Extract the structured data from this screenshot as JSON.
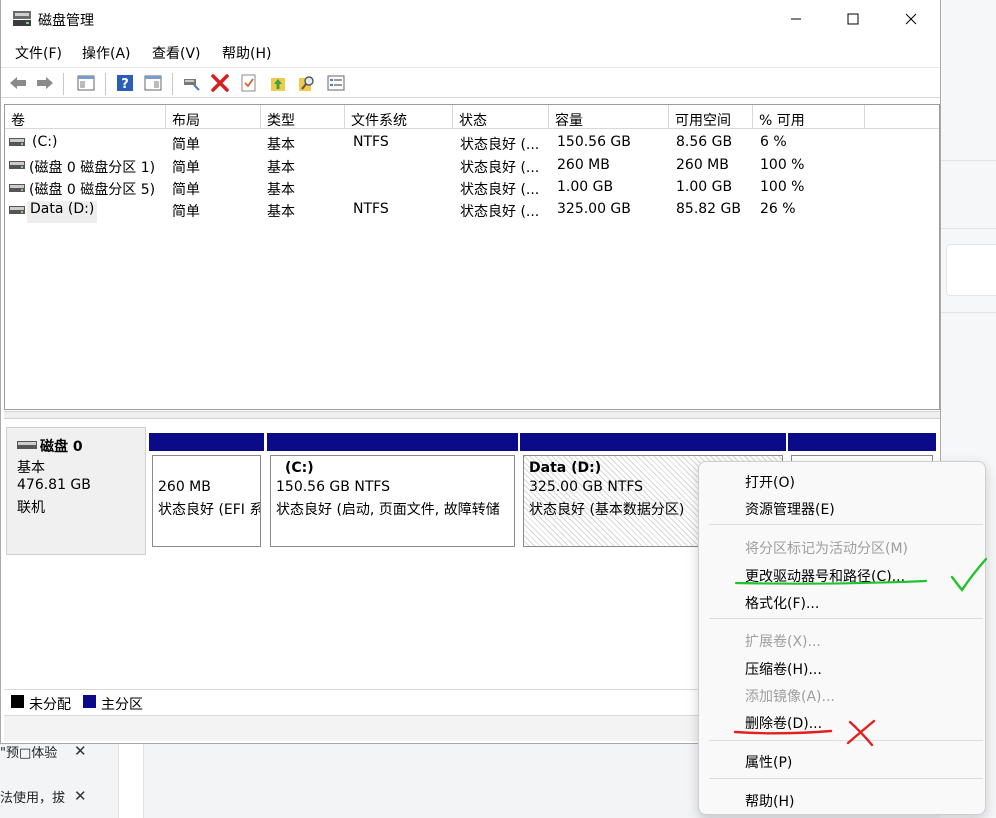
{
  "window": {
    "title": "磁盘管理"
  },
  "menubar": [
    "文件(F)",
    "操作(A)",
    "查看(V)",
    "帮助(H)"
  ],
  "columns": [
    "卷",
    "布局",
    "类型",
    "文件系统",
    "状态",
    "容量",
    "可用空间",
    "% 可用"
  ],
  "volumes": [
    {
      "name": "(C:)",
      "layout": "简单",
      "type": "基本",
      "fs": "NTFS",
      "status": "状态良好 (...",
      "capacity": "150.56 GB",
      "free": "8.56 GB",
      "pct": "6 %"
    },
    {
      "name": "(磁盘 0 磁盘分区 1)",
      "layout": "简单",
      "type": "基本",
      "fs": "",
      "status": "状态良好 (...",
      "capacity": "260 MB",
      "free": "260 MB",
      "pct": "100 %"
    },
    {
      "name": "(磁盘 0 磁盘分区 5)",
      "layout": "简单",
      "type": "基本",
      "fs": "",
      "status": "状态良好 (...",
      "capacity": "1.00 GB",
      "free": "1.00 GB",
      "pct": "100 %"
    },
    {
      "name": "Data (D:)",
      "layout": "简单",
      "type": "基本",
      "fs": "NTFS",
      "status": "状态良好 (...",
      "capacity": "325.00 GB",
      "free": "85.82 GB",
      "pct": "26 %"
    }
  ],
  "disk": {
    "name": "磁盘 0",
    "type": "基本",
    "size": "476.81 GB",
    "state": "联机"
  },
  "partitions": [
    {
      "title": "",
      "size": "260 MB",
      "status": "状态良好 (EFI 系"
    },
    {
      "title": "(C:)",
      "size": "150.56 GB NTFS",
      "status": "状态良好 (启动, 页面文件, 故障转储"
    },
    {
      "title": "Data  (D:)",
      "size": "325.00 GB NTFS",
      "status": "状态良好 (基本数据分区)"
    }
  ],
  "legend": {
    "unallocated": "未分配",
    "primary": "主分区"
  },
  "context_menu": {
    "open": "打开(O)",
    "explore": "资源管理器(E)",
    "mark_active": "将分区标记为活动分区(M)",
    "change_letter": "更改驱动器号和路径(C)...",
    "format": "格式化(F)...",
    "extend": "扩展卷(X)...",
    "shrink": "压缩卷(H)...",
    "add_mirror": "添加镜像(A)...",
    "delete": "删除卷(D)...",
    "properties": "属性(P)",
    "help": "帮助(H)"
  },
  "background": {
    "item1": "\"预□体验",
    "item2": "法使用，拔"
  },
  "colors": {
    "primary_partition": "#0b0b89",
    "unallocated": "#000000",
    "check_mark": "#22c22e",
    "cross_mark": "#e32020"
  }
}
